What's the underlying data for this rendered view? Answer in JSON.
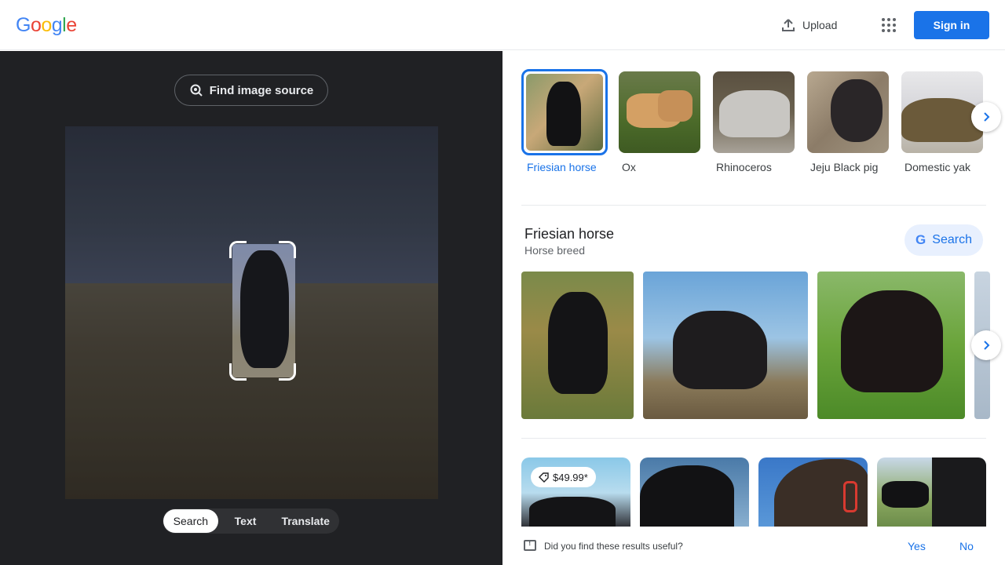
{
  "header": {
    "logo": "Google",
    "upload_label": "Upload",
    "signin_label": "Sign in"
  },
  "left_panel": {
    "find_source_label": "Find image source",
    "modes": [
      {
        "label": "Search",
        "active": true
      },
      {
        "label": "Text",
        "active": false
      },
      {
        "label": "Translate",
        "active": false
      }
    ]
  },
  "related": {
    "items": [
      {
        "label": "Friesian horse",
        "selected": true
      },
      {
        "label": "Ox",
        "selected": false
      },
      {
        "label": "Rhinoceros",
        "selected": false
      },
      {
        "label": "Jeju Black pig",
        "selected": false
      },
      {
        "label": "Domestic yak",
        "selected": false
      }
    ]
  },
  "entity": {
    "title": "Friesian horse",
    "subtitle": "Horse breed",
    "search_label": "Search"
  },
  "results": {
    "price": "$49.99*"
  },
  "feedback": {
    "question": "Did you find these results useful?",
    "yes": "Yes",
    "no": "No"
  },
  "colors": {
    "accent": "#1a73e8",
    "dark_panel": "#202124",
    "google_blue": "#4285F4",
    "google_red": "#EA4335",
    "google_yellow": "#FBBC05",
    "google_green": "#34A853"
  }
}
